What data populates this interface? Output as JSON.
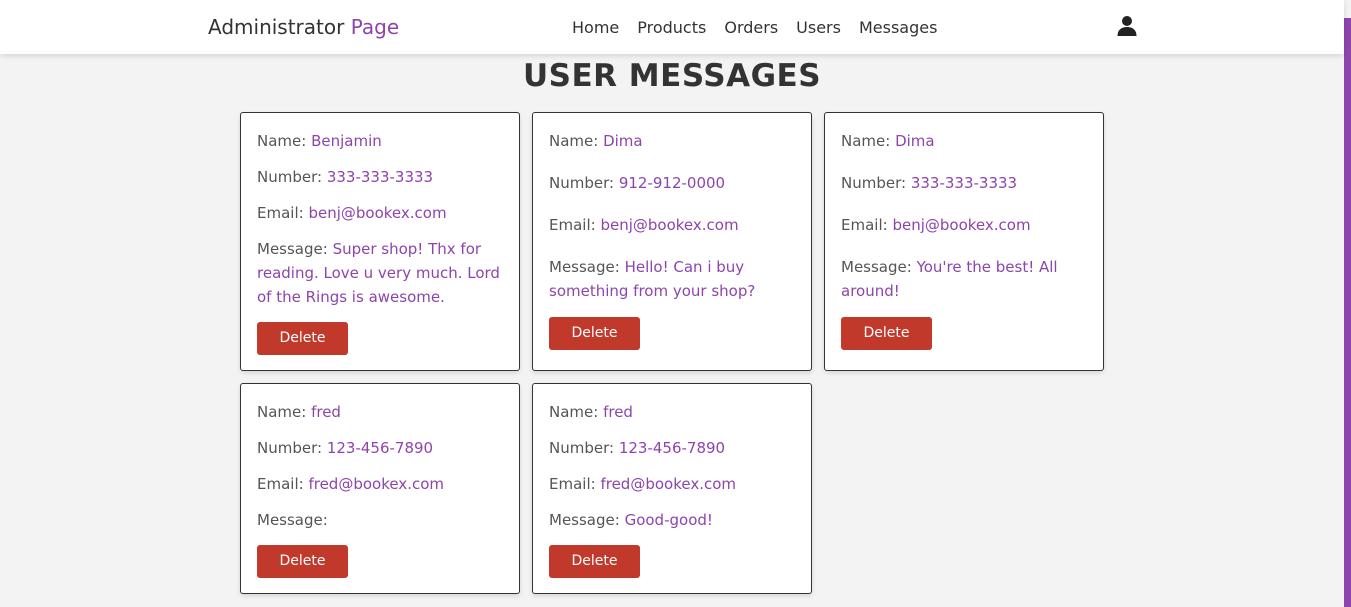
{
  "header": {
    "logo_main": "Administrator",
    "logo_accent": "Page",
    "nav": [
      "Home",
      "Products",
      "Orders",
      "Users",
      "Messages"
    ],
    "user_icon": "user-icon"
  },
  "page": {
    "title": "USER MESSAGES"
  },
  "labels": {
    "name": "Name: ",
    "number": "Number: ",
    "email": "Email: ",
    "message": "Message: ",
    "delete": "Delete"
  },
  "messages": [
    {
      "name": "Benjamin",
      "number": "333-333-3333",
      "email": "benj@bookex.com",
      "message": "Super shop! Thx for reading. Love u very much. Lord of the Rings is awesome."
    },
    {
      "name": "Dima",
      "number": "912-912-0000",
      "email": "benj@bookex.com",
      "message": "Hello! Can i buy something from your shop?"
    },
    {
      "name": "Dima",
      "number": "333-333-3333",
      "email": "benj@bookex.com",
      "message": "You're the best! All around!"
    },
    {
      "name": "fred",
      "number": "123-456-7890",
      "email": "fred@bookex.com",
      "message": ""
    },
    {
      "name": "fred",
      "number": "123-456-7890",
      "email": "fred@bookex.com",
      "message": "Good-good!"
    }
  ],
  "colors": {
    "accent": "#8e44ad",
    "delete": "#c0392b",
    "text": "#333333"
  }
}
